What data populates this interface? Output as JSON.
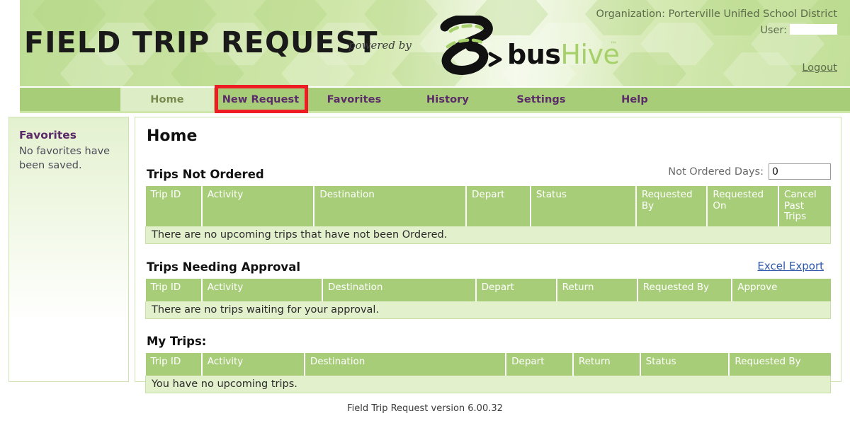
{
  "header": {
    "app_title": "FIELD TRIP REQUEST",
    "powered_by": "powered by",
    "brand_bus": "bus",
    "brand_hive": "Hive",
    "brand_tm": "™",
    "organization": "Organization: Porterville Unified School District",
    "user_label": "User:",
    "user_value": "",
    "logout": "Logout"
  },
  "nav": {
    "tabs": [
      {
        "label": "Home",
        "active": true
      },
      {
        "label": "New Request",
        "active": false
      },
      {
        "label": "Favorites",
        "active": false
      },
      {
        "label": "History",
        "active": false
      },
      {
        "label": "Settings",
        "active": false
      },
      {
        "label": "Help",
        "active": false
      }
    ],
    "highlighted_tab": "New Request"
  },
  "sidebar": {
    "title": "Favorites",
    "empty_message": "No favorites have been saved."
  },
  "main": {
    "page_title": "Home",
    "sections": [
      {
        "title": "Trips Not Ordered",
        "not_ordered_days_label": "Not Ordered Days:",
        "not_ordered_days_value": "0",
        "columns": [
          "Trip ID",
          "Activity",
          "Destination",
          "Depart",
          "Status",
          "Requested By",
          "Requested On",
          "Cancel Past Trips"
        ],
        "empty_message": "There are no upcoming trips that have not been Ordered."
      },
      {
        "title": "Trips Needing Approval",
        "excel_export": "Excel Export",
        "columns": [
          "Trip ID",
          "Activity",
          "Destination",
          "Depart",
          "Return",
          "Requested By",
          "Approve"
        ],
        "empty_message": "There are no trips waiting for your approval."
      },
      {
        "title": "My Trips:",
        "columns": [
          "Trip ID",
          "Activity",
          "Destination",
          "Depart",
          "Return",
          "Status",
          "Requested By"
        ],
        "empty_message": "You have no upcoming trips."
      }
    ]
  },
  "footer": {
    "version_text": "Field Trip Request version 6.00.32"
  },
  "colors": {
    "nav_green": "#a8cd79",
    "nav_active": "#ddeec6",
    "tab_text": "#5b2a69",
    "row_green": "#e2f0cc",
    "highlight_red": "#ee1d23",
    "link_blue": "#2d57a8"
  }
}
